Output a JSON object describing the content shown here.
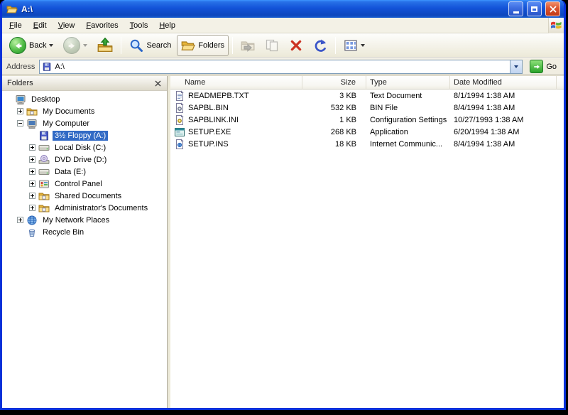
{
  "window": {
    "title": "A:\\"
  },
  "menu": {
    "items": [
      "File",
      "Edit",
      "View",
      "Favorites",
      "Tools",
      "Help"
    ]
  },
  "toolbar": {
    "back_label": "Back",
    "search_label": "Search",
    "folders_label": "Folders"
  },
  "address": {
    "label": "Address",
    "value": "A:\\",
    "go_label": "Go"
  },
  "icons": {
    "titlebar": "open-folder-icon",
    "back": "green-circle-left-arrow",
    "forward": "green-circle-right-arrow-disabled",
    "up": "folder-up-arrow",
    "search": "magnifier",
    "folders": "folder",
    "move_to": "folder-move-disabled",
    "copy_to": "copy-disabled",
    "delete": "red-x",
    "undo": "blue-undo-arrow",
    "views": "views-grid",
    "go": "green-right-arrow",
    "logo": "windows-flag"
  },
  "folders_pane": {
    "header": "Folders",
    "tree": [
      {
        "label": "Desktop"
      },
      {
        "label": "My Documents"
      },
      {
        "label": "My Computer"
      },
      {
        "label": "3½ Floppy (A:)"
      },
      {
        "label": "Local Disk (C:)"
      },
      {
        "label": "DVD Drive (D:)"
      },
      {
        "label": "Data (E:)"
      },
      {
        "label": "Control Panel"
      },
      {
        "label": "Shared Documents"
      },
      {
        "label": "Administrator's Documents"
      },
      {
        "label": "My Network Places"
      },
      {
        "label": "Recycle Bin"
      }
    ]
  },
  "file_list": {
    "columns": [
      "Name",
      "Size",
      "Type",
      "Date Modified"
    ],
    "rows": [
      {
        "name": "READMEPB.TXT",
        "size": "3 KB",
        "type": "Text Document",
        "modified": "8/1/1994 1:38 AM"
      },
      {
        "name": "SAPBL.BIN",
        "size": "532 KB",
        "type": "BIN File",
        "modified": "8/4/1994 1:38 AM"
      },
      {
        "name": "SAPBLINK.INI",
        "size": "1 KB",
        "type": "Configuration Settings",
        "modified": "10/27/1993 1:38 AM"
      },
      {
        "name": "SETUP.EXE",
        "size": "268 KB",
        "type": "Application",
        "modified": "6/20/1994 1:38 AM"
      },
      {
        "name": "SETUP.INS",
        "size": "18 KB",
        "type": "Internet Communic...",
        "modified": "8/4/1994 1:38 AM"
      }
    ]
  }
}
